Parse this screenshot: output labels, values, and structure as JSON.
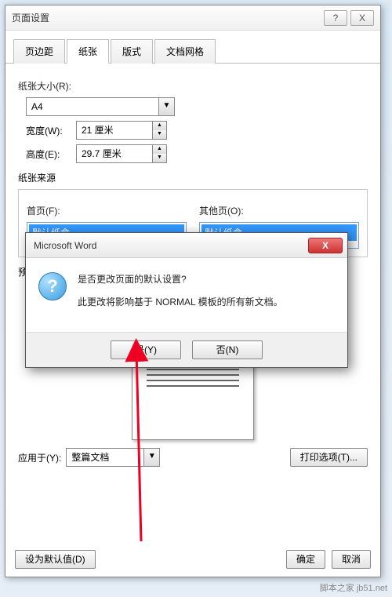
{
  "dialog": {
    "title": "页面设置",
    "help_glyph": "?",
    "close_glyph": "X",
    "tabs": [
      "页边距",
      "纸张",
      "版式",
      "文档网格"
    ],
    "active_tab": 1,
    "paper_size_label": "纸张大小(R):",
    "paper_size_value": "A4",
    "width_label": "宽度(W):",
    "width_value": "21 厘米",
    "height_label": "高度(E):",
    "height_value": "29.7 厘米",
    "source_label": "纸张来源",
    "first_page_label": "首页(F):",
    "other_page_label": "其他页(O):",
    "default_tray": "默认纸盒",
    "preview_label": "预览",
    "apply_to_label": "应用于(Y):",
    "apply_to_value": "整篇文档",
    "print_options": "打印选项(T)...",
    "set_default": "设为默认值(D)",
    "ok": "确定",
    "cancel": "取消"
  },
  "msgbox": {
    "title": "Microsoft Word",
    "line1": "是否更改页面的默认设置?",
    "line2": "此更改将影响基于 NORMAL 模板的所有新文档。",
    "yes": "是(Y)",
    "no": "否(N)"
  },
  "watermark": "脚本之家 jb51.net"
}
